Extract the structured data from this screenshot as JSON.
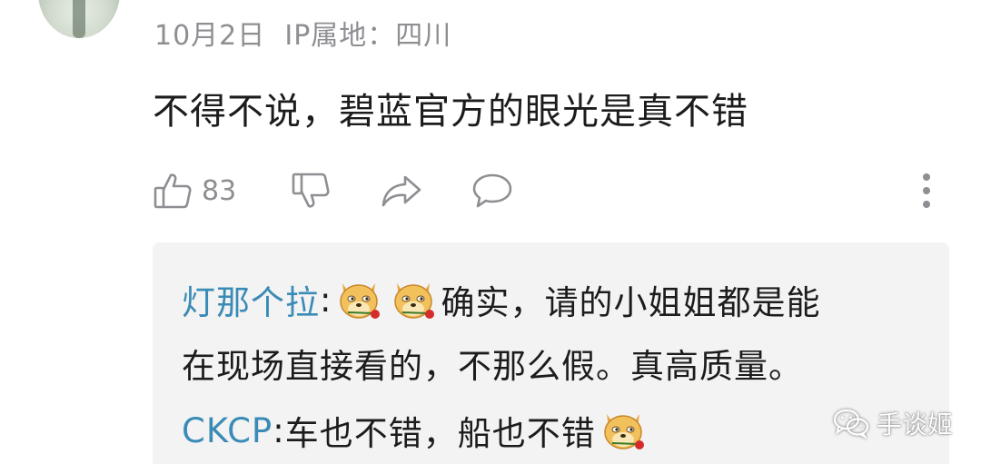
{
  "comment": {
    "date": "10月2日",
    "ip_location": "IP属地：四川",
    "text": "不得不说，碧蓝官方的眼光是真不错",
    "like_count": "83"
  },
  "replies": [
    {
      "name": "灯那个拉",
      "separator": ": ",
      "line1": "确实，请的小姐姐都是能",
      "line2": "在现场直接看的，不那么假。真高质量。",
      "emoji_icon": "doge-rose-icon"
    },
    {
      "name": "CKCP",
      "separator": ": ",
      "text": "车也不错，船也不错",
      "emoji_icon": "doge-rose-icon"
    }
  ],
  "watermark": {
    "text": "手谈姬",
    "icon": "wechat-icon"
  },
  "colors": {
    "meta_gray": "#8e8e93",
    "reply_name_blue": "#3a8bb6",
    "reply_bg": "#f3f3f3"
  }
}
